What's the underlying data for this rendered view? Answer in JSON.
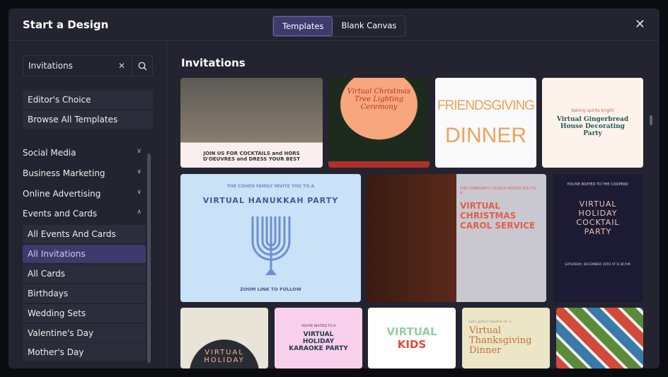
{
  "header": {
    "title": "Start a Design",
    "tabs": [
      "Templates",
      "Blank Canvas"
    ],
    "active_tab": "Templates"
  },
  "search": {
    "value": "Invitations"
  },
  "sidebar": {
    "quick": [
      "Editor's Choice",
      "Browse All Templates"
    ],
    "categories": [
      "Social Media",
      "Business Marketing",
      "Online Advertising",
      "Events and Cards"
    ],
    "subitems": [
      "All Events And Cards",
      "All Invitations",
      "All Cards",
      "Birthdays",
      "Wedding Sets",
      "Valentine's Day",
      "Mother's Day"
    ],
    "active": "All Invitations"
  },
  "main": {
    "title": "Invitations",
    "cards": [
      {
        "t": "JOIN US FOR COCKTAILS and HORS D'OEUVRES and DRESS YOUR BEST"
      },
      {
        "t": "Virtual Christmas Tree Lighting Ceremony"
      },
      {
        "t": "FRIENDSGIVING",
        "t2": "DINNER"
      },
      {
        "t": "baking spirits bright",
        "t2": "Virtual Gingerbread House Decorating Party"
      },
      {
        "t": "THE COHEN FAMILY INVITE YOU TO A",
        "t2": "VIRTUAL HANUKKAH PARTY",
        "t3": "ZOOM LINK TO FOLLOW"
      },
      {
        "t": "THE COMMUNITY CHURCH INVITES YOU TO A",
        "t2": "VIRTUAL CHRISTMAS CAROL SERVICE"
      },
      {
        "t": "YOU'RE INVITED TO THE COOPERS'",
        "t2": "VIRTUAL HOLIDAY COCKTAIL PARTY",
        "t3": "SATURDAY, DECEMBER 19TH AT 6:30 P.M."
      },
      {
        "t": "VIRTUAL HOLIDAY"
      },
      {
        "t": "YOU'RE INVITED TO A",
        "t2": "VIRTUAL HOLIDAY KARAOKE PARTY"
      },
      {
        "t": "VIRTUAL",
        "t2": "KIDS"
      },
      {
        "t": "Let's gather together for a",
        "t2": "Virtual Thanksgiving Dinner"
      },
      {
        "t": ""
      }
    ]
  }
}
